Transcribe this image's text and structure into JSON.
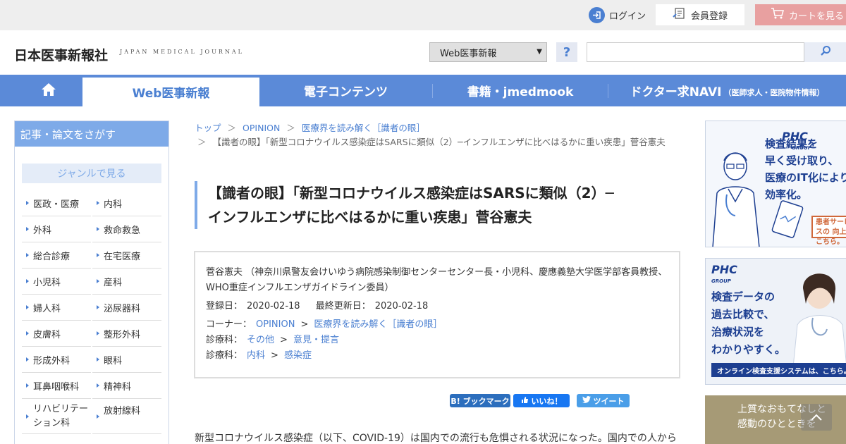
{
  "topbar": {
    "login_label": "ログイン",
    "member_label": "会員登録",
    "cart_label": "カートを見る"
  },
  "header": {
    "logo": "日本医事新報社",
    "logo_sub": "JAPAN MEDICAL JOURNAL",
    "select_value": "Web医事新報",
    "help_label": "?"
  },
  "nav": {
    "items": [
      {
        "label": "Web医事新報"
      },
      {
        "label": "電子コンテンツ"
      },
      {
        "label": "書籍・jmedmook"
      },
      {
        "label": "ドクター求NAVI",
        "small": "（医師求人・医院物件情報）"
      }
    ]
  },
  "sidebar": {
    "heading": "記事・論文をさがす",
    "genre_button": "ジャンルで見る",
    "categories": [
      {
        "label": "医政・医療"
      },
      {
        "label": "内科"
      },
      {
        "label": "外科"
      },
      {
        "label": "救命救急"
      },
      {
        "label": "総合診療"
      },
      {
        "label": "在宅医療"
      },
      {
        "label": "小児科"
      },
      {
        "label": "産科"
      },
      {
        "label": "婦人科"
      },
      {
        "label": "泌尿器科"
      },
      {
        "label": "皮膚科"
      },
      {
        "label": "整形外科"
      },
      {
        "label": "形成外科"
      },
      {
        "label": "眼科"
      },
      {
        "label": "耳鼻咽喉科"
      },
      {
        "label": "精神科"
      },
      {
        "label": "リハビリテーション科"
      },
      {
        "label": "放射線科"
      }
    ]
  },
  "breadcrumb": {
    "sep": "＞",
    "items": [
      "トップ",
      "OPINION",
      "医療界を読み解く［識者の眼］"
    ],
    "current": "【識者の眼】「新型コロナウイルス感染症はSARSに類似（2）─インフルエンザに比べはるかに重い疾患」菅谷憲夫"
  },
  "article": {
    "title_line1": "【識者の眼】「新型コロナウイルス感染症はSARSに類似（2）─",
    "title_line2": "インフルエンザに比べはるかに重い疾患」菅谷憲夫",
    "author": "菅谷憲夫 （神奈川県警友会けいゆう病院感染制御センターセンター長・小児科、慶應義塾大学医学部客員教授、WHO重症インフルエンザガイドライン委員）",
    "registered_label": "登録日：",
    "registered_date": "2020-02-18",
    "updated_label": "最終更新日：",
    "updated_date": "2020-02-18",
    "corner_label": "コーナー：",
    "corner_link1": "OPINION",
    "corner_link2": "医療界を読み解く［識者の眼］",
    "dept_label": "診療科：",
    "dept1_a": "その他",
    "dept1_b": "意見・提言",
    "dept2_a": "内科",
    "dept2_b": "感染症",
    "gt": ">",
    "body_start": "新型コロナウイルス感染症（以下、COVID-19）は国内での流行も危惧される状況になった。国内での人から"
  },
  "share": {
    "bookmark": "B! ブックマーク",
    "like": "いいね！",
    "tweet": "ツイート",
    "bookmark_color": "#2c6ebd",
    "like_color": "#1877f2",
    "tweet_color": "#4a9ee8"
  },
  "ads": {
    "ad1_brand": "PHC",
    "ad1_brand_sub": "GROUP",
    "ad1_lines": [
      "検査結果を",
      "早く受け取り、",
      "医療のIT化により",
      "効率化。"
    ],
    "ad1_tag": "患者サービスの 向上はこちら。",
    "ad2_brand": "PHC",
    "ad2_brand_sub": "GROUP",
    "ad2_lines": [
      "検査データの",
      "過去比較で、",
      "治療状況を",
      "わかりやすく。"
    ],
    "ad2_footer": "オンライン検査支援システムは、こちら。",
    "ad3_lines": [
      "上質なおもてなしと",
      "感動のひとときを"
    ]
  },
  "colors": {
    "accent": "#4a7fd1",
    "nav": "#5b8ad8",
    "sidebar_head": "#7eaae8",
    "cart": "#e8a0a0"
  }
}
